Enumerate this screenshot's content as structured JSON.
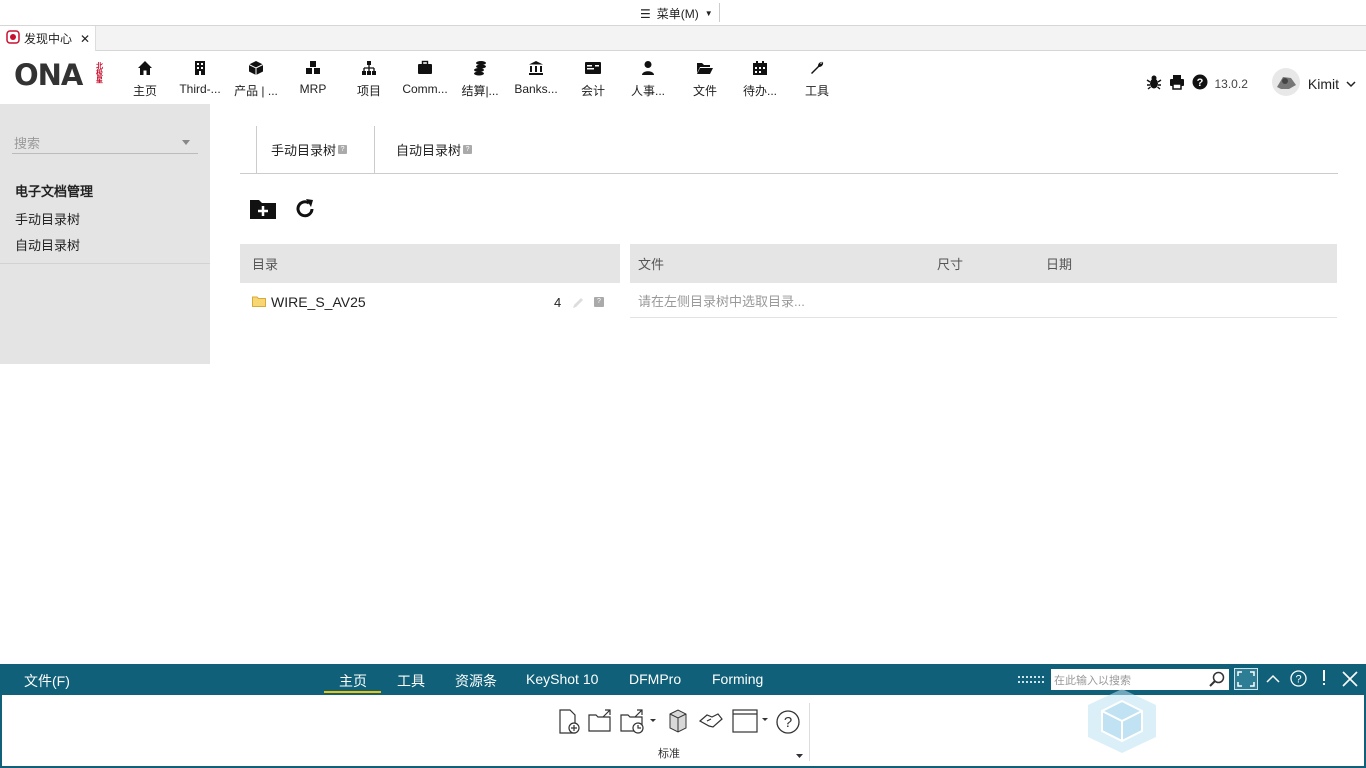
{
  "titlebar": {
    "menu_label": "菜单(M)"
  },
  "tab": {
    "title": "发现中心"
  },
  "logo": {
    "text": "ONA",
    "dot_text": "北极\n星"
  },
  "nav": [
    {
      "label": "主页",
      "icon": "home-icon"
    },
    {
      "label": "Third-...",
      "icon": "building-icon"
    },
    {
      "label": "产品 | ...",
      "icon": "cube-icon"
    },
    {
      "label": "MRP",
      "icon": "cubes-icon"
    },
    {
      "label": "项目",
      "icon": "sitemap-icon"
    },
    {
      "label": "Comm...",
      "icon": "briefcase-icon"
    },
    {
      "label": "结算|...",
      "icon": "coins-icon"
    },
    {
      "label": "Banks...",
      "icon": "bank-icon"
    },
    {
      "label": "会计",
      "icon": "ledger-icon"
    },
    {
      "label": "人事...",
      "icon": "user-icon"
    },
    {
      "label": "文件",
      "icon": "folder-open-icon"
    },
    {
      "label": "待办...",
      "icon": "calendar-icon"
    },
    {
      "label": "工具",
      "icon": "wrench-icon"
    }
  ],
  "nav_right": {
    "version": "13.0.2",
    "user": "Kimit"
  },
  "sidebar": {
    "search_placeholder": "搜索",
    "title": "电子文档管理",
    "links": [
      "手动目录树",
      "自动目录树"
    ]
  },
  "subtabs": [
    "手动目录树",
    "自动目录树"
  ],
  "dir_panel": {
    "header": "目录",
    "rows": [
      {
        "name": "WIRE_S_AV25",
        "count": "4"
      }
    ]
  },
  "file_panel": {
    "headers": [
      "文件",
      "尺寸",
      "日期"
    ],
    "empty_text": "请在左侧目录树中选取目录..."
  },
  "ribbon": {
    "file_tab": "文件(F)",
    "tabs": [
      "主页",
      "工具",
      "资源条",
      "KeyShot 10",
      "DFMPro",
      "Forming"
    ],
    "active_tab": "主页",
    "search_placeholder": "在此输入以搜索",
    "group_label": "标准"
  },
  "colors": {
    "ribbon": "#0f6078",
    "accent": "#f5c400",
    "logo_red": "#c8102e"
  }
}
